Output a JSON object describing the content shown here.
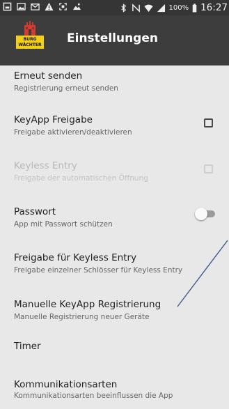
{
  "status_bar": {
    "icons": [
      "checkbox-outline-icon",
      "image-icon",
      "mail-icon",
      "warning-icon",
      "screenshot-icon",
      "photo-icon",
      "bluetooth-icon",
      "nfc-icon",
      "wifi-icon",
      "signal-icon"
    ],
    "battery": "100%",
    "battery_icon": "battery-full-icon",
    "time": "16:27"
  },
  "toolbar": {
    "title": "Einstellungen",
    "logo": {
      "line1": "BURG",
      "line2": "WÄCHTER",
      "colors": {
        "bar": "#f3cf16",
        "emblem": "#d63a2e"
      }
    }
  },
  "settings": [
    {
      "title": "Erneut senden",
      "summary": "Registrierung erneut senden"
    },
    {
      "title": "KeyApp Freigabe",
      "summary": "Freigabe aktivieren/deaktivieren",
      "control": "checkbox",
      "checked": false
    },
    {
      "title": "Keyless Entry",
      "summary": "Freigabe der automatischen Öffnung",
      "control": "checkbox",
      "checked": false,
      "enabled": false
    },
    {
      "title": "Passwort",
      "summary": "App mit Passwort schützen",
      "control": "switch",
      "on": false
    },
    {
      "title": "Freigabe für Keyless Entry",
      "summary": "Freigabe einzelner Schlösser für Keyless Entry"
    },
    {
      "title": "Manuelle KeyApp Registrierung",
      "summary": "Manuelle Registrierung neuer Geräte"
    },
    {
      "title": "Timer"
    },
    {
      "title": "Kommunikationsarten",
      "summary": "Kommunikationsarten beeinflussen die App"
    }
  ],
  "annotation": {
    "color": "#3a5a8c"
  }
}
